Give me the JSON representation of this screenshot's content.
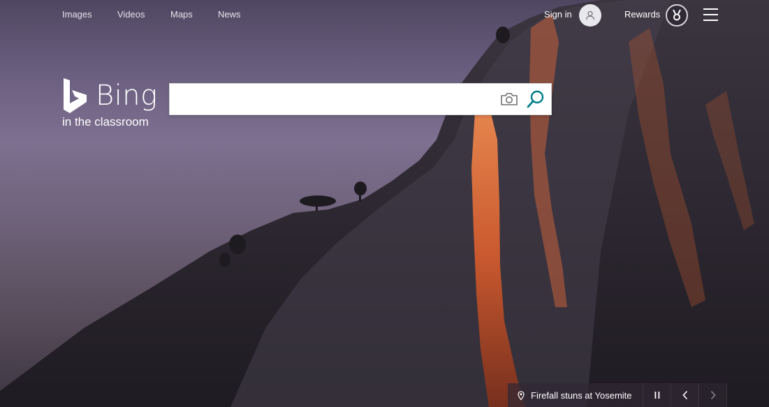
{
  "topnav": {
    "links": [
      "Images",
      "Videos",
      "Maps",
      "News"
    ],
    "signin_label": "Sign in",
    "rewards_label": "Rewards"
  },
  "logo": {
    "word": "Bing",
    "subtitle": "in the classroom"
  },
  "search": {
    "value": "",
    "placeholder": ""
  },
  "caption": {
    "text": "Firefall stuns at Yosemite"
  },
  "icons": {
    "avatar": "user-icon",
    "rewards": "medal-icon",
    "menu": "hamburger-icon",
    "camera": "camera-icon",
    "search": "search-icon",
    "location": "map-pin-icon",
    "pause": "pause-icon",
    "prev": "chevron-left-icon",
    "next": "chevron-right-icon"
  },
  "colors": {
    "search_accent": "#007c8a",
    "sky": "#7d7090",
    "rock": "#2f2a35",
    "firefall": "#d6643a"
  }
}
